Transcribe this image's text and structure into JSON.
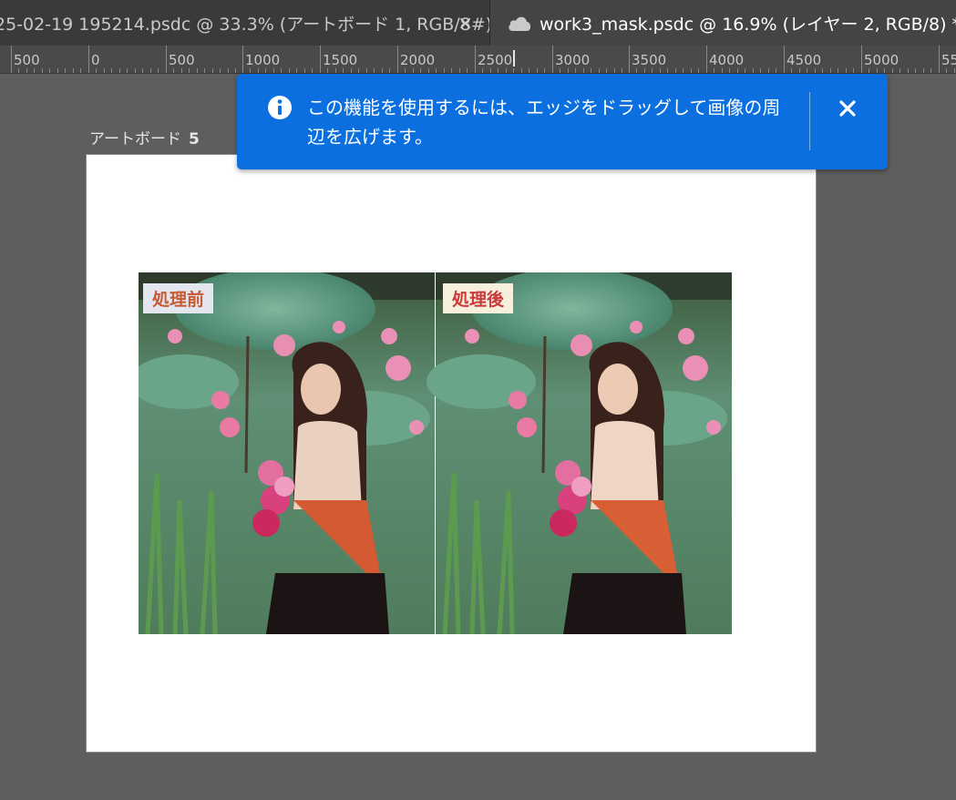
{
  "tabs": [
    {
      "title": "25-02-19 195214.psdc @ 33.3% (アートボード 1, RGB/8#)",
      "close_glyph": "×",
      "active": false
    },
    {
      "title": "work3_mask.psdc @ 16.9% (レイヤー 2, RGB/8) *",
      "close_glyph": "×",
      "active": true,
      "icon": "cloud-icon"
    }
  ],
  "ruler": {
    "labels": [
      "500",
      "0",
      "500",
      "1000",
      "1500",
      "2000",
      "2500",
      "3000",
      "3500",
      "4000",
      "4500",
      "5000",
      "55"
    ]
  },
  "artboard": {
    "label": "アートボード",
    "number": "5"
  },
  "image": {
    "before_label": "処理前",
    "after_label": "処理後"
  },
  "notification": {
    "icon": "info-icon",
    "message": "この機能を使用するには、エッジをドラッグして画像の周辺を広げます。",
    "close_icon": "close-icon",
    "color": "#0b6fe0"
  },
  "colors": {
    "canvas_bg": "#5e5e5e",
    "tab_bar": "#3a3a3a",
    "active_tab": "#444444"
  }
}
